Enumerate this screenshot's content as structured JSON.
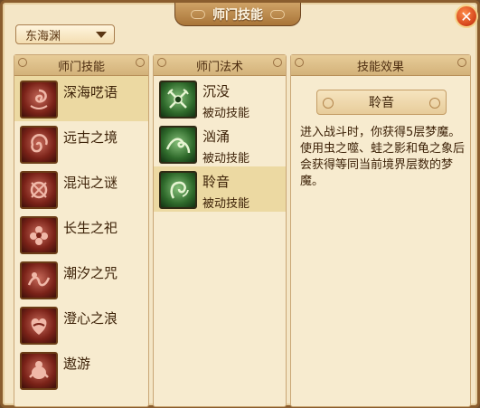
{
  "window": {
    "title": "师门技能",
    "close_label": "✕"
  },
  "school_selector": {
    "selected": "东海渊"
  },
  "left_panel": {
    "header": "师门技能",
    "items": [
      {
        "label": "深海呓语",
        "icon": "red-swirl-emblem-icon",
        "selected": true
      },
      {
        "label": "远古之境",
        "icon": "red-spiral-emblem-icon",
        "selected": false
      },
      {
        "label": "混沌之谜",
        "icon": "red-knot-emblem-icon",
        "selected": false
      },
      {
        "label": "长生之祀",
        "icon": "red-flower-emblem-icon",
        "selected": false
      },
      {
        "label": "潮汐之咒",
        "icon": "red-tide-emblem-icon",
        "selected": false
      },
      {
        "label": "澄心之浪",
        "icon": "red-heart-wave-icon",
        "selected": false
      },
      {
        "label": "遨游",
        "icon": "red-creature-emblem-icon",
        "selected": false
      }
    ]
  },
  "middle_panel": {
    "header": "师门法术",
    "items": [
      {
        "name": "沉没",
        "type": "被动技能",
        "icon": "green-crossed-tridents-icon",
        "selected": false
      },
      {
        "name": "汹涌",
        "type": "被动技能",
        "icon": "green-wave-icon",
        "selected": false
      },
      {
        "name": "聆音",
        "type": "被动技能",
        "icon": "green-listening-icon",
        "selected": true
      }
    ]
  },
  "right_panel": {
    "header": "技能效果",
    "skill_title": "聆音",
    "description": "进入战斗时，你获得5层梦魔。使用虫之噬、蛙之影和龟之象后会获得等同当前境界层数的梦魔。"
  },
  "colors": {
    "window_bg": "#f4e6c6",
    "frame": "#8a5d2e",
    "selected_row": "#ecd9a2",
    "text": "#3d2208"
  }
}
